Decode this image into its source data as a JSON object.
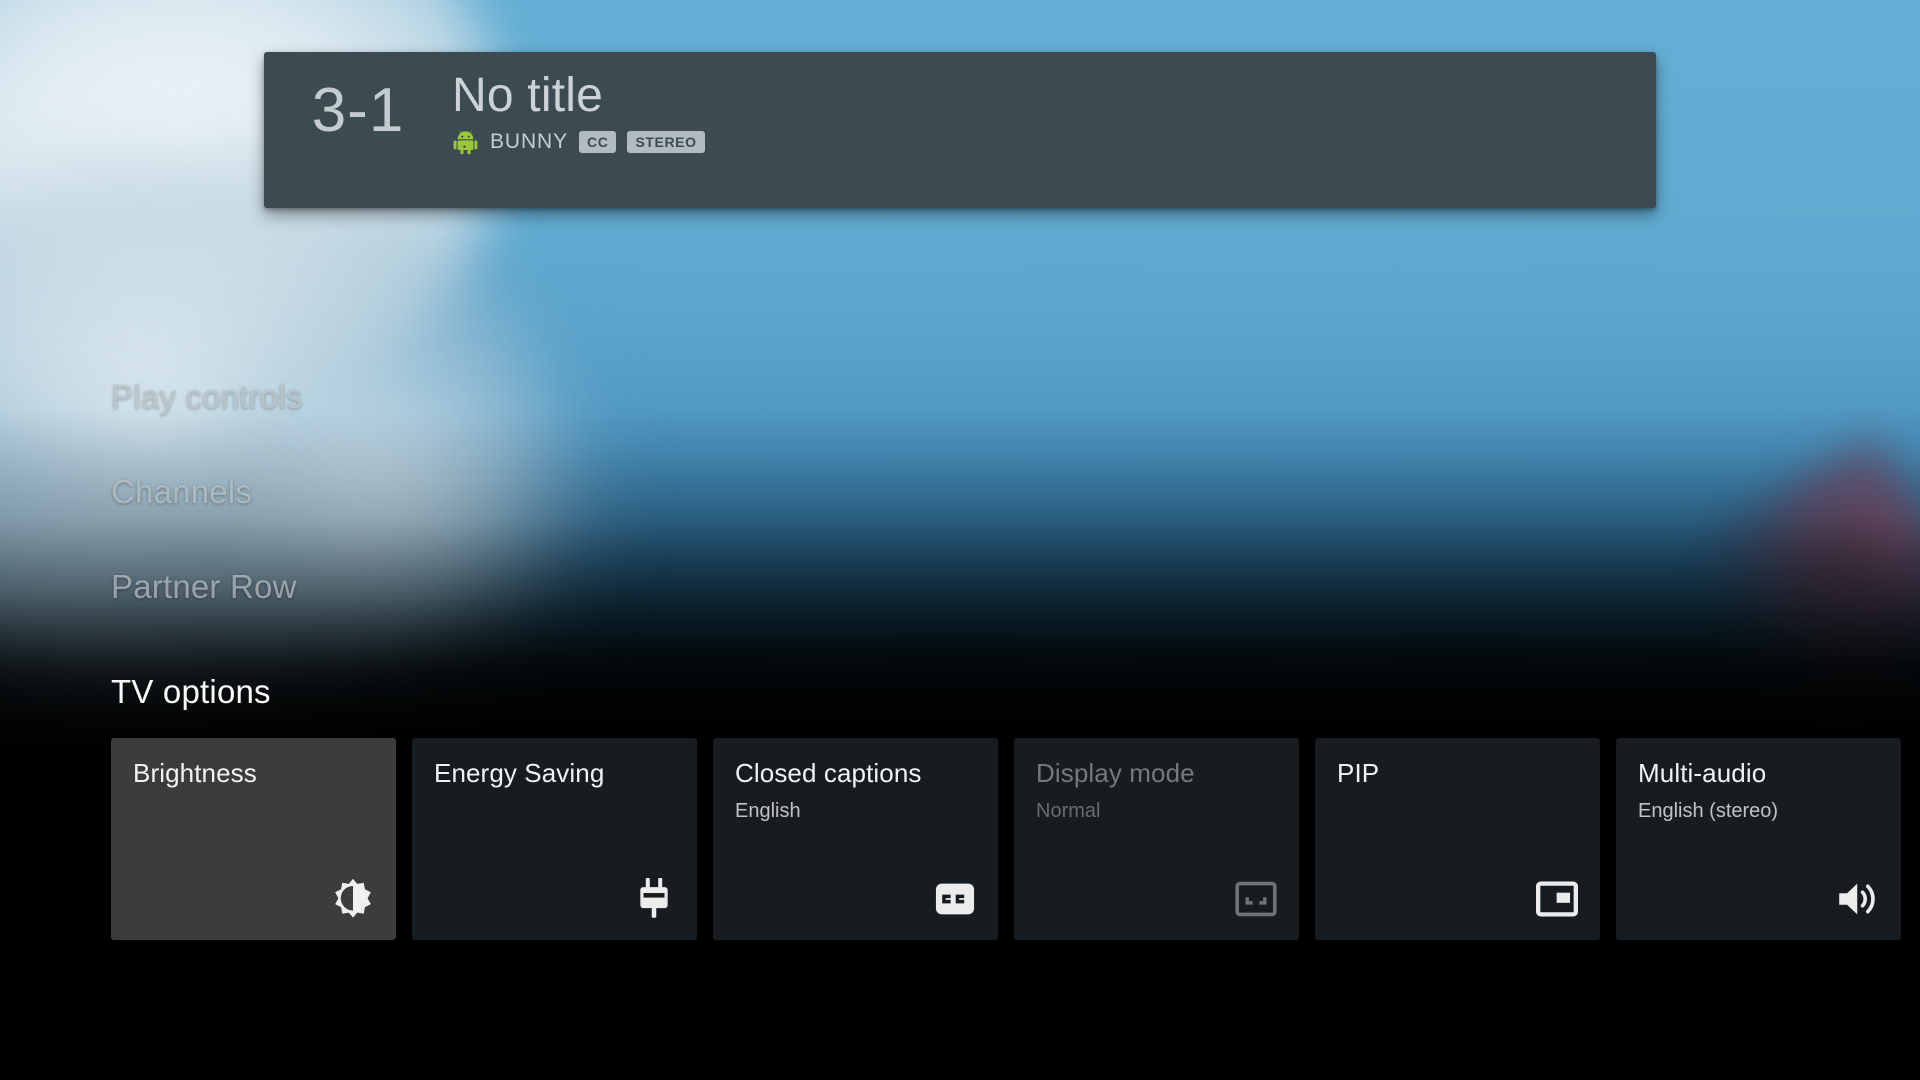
{
  "banner": {
    "channel_number": "3-1",
    "title": "No title",
    "app_icon": "android-robot-icon",
    "channel_name": "BUNNY",
    "badges": [
      "CC",
      "STEREO"
    ],
    "background_color": "#3c4b51"
  },
  "row_menu": {
    "items": [
      {
        "label": "Play controls",
        "name": "play-controls"
      },
      {
        "label": "Channels",
        "name": "channels"
      },
      {
        "label": "Partner Row",
        "name": "partner-row"
      }
    ]
  },
  "tv_options": {
    "title": "TV options",
    "cards": [
      {
        "title": "Brightness",
        "subtitle": "",
        "icon": "brightness-icon",
        "focused": true,
        "disabled": false
      },
      {
        "title": "Energy Saving",
        "subtitle": "",
        "icon": "power-plug-icon",
        "focused": false,
        "disabled": false
      },
      {
        "title": "Closed captions",
        "subtitle": "English",
        "icon": "cc-icon",
        "focused": false,
        "disabled": false
      },
      {
        "title": "Display mode",
        "subtitle": "Normal",
        "icon": "aspect-ratio-icon",
        "focused": false,
        "disabled": true
      },
      {
        "title": "PIP",
        "subtitle": "",
        "icon": "picture-in-picture-icon",
        "focused": false,
        "disabled": false
      },
      {
        "title": "Multi-audio",
        "subtitle": "English (stereo)",
        "icon": "volume-up-icon",
        "focused": false,
        "disabled": false
      }
    ]
  },
  "colors": {
    "focus_card": "#3c3c3c",
    "card": "#171c20",
    "banner": "#3c4b51",
    "badge": "#b2bcc0",
    "text_primary": "#f3f3f3",
    "text_secondary": "#c2c2c2",
    "text_disabled": "#787878"
  }
}
